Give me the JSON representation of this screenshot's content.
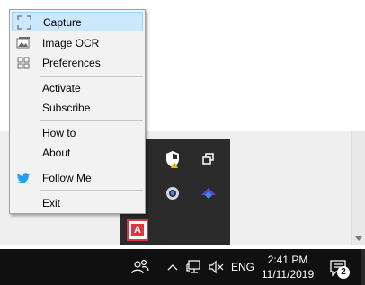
{
  "menu": {
    "items": [
      {
        "label": "Capture",
        "icon": "capture-icon",
        "selected": true
      },
      {
        "label": "Image OCR",
        "icon": "image-icon"
      },
      {
        "label": "Preferences",
        "icon": "grid-icon"
      },
      {
        "label": "Activate"
      },
      {
        "label": "Subscribe"
      },
      {
        "label": "How to"
      },
      {
        "label": "About"
      },
      {
        "label": "Follow Me",
        "icon": "twitter-icon"
      },
      {
        "label": "Exit"
      }
    ]
  },
  "tray_flyout": {
    "icons": [
      "security-shield-icon",
      "multi-window-icon",
      "ring-icon",
      "arrow-up-icon",
      "app-a-icon"
    ],
    "app_letter": "A"
  },
  "taskbar": {
    "language": "ENG",
    "time": "2:41 PM",
    "date": "11/11/2019",
    "notification_count": "2"
  },
  "colors": {
    "menu_bg": "#f2f2f2",
    "menu_highlight": "#cce8ff",
    "taskbar_bg": "#101010",
    "flyout_bg": "#2b2b2b",
    "twitter_blue": "#1da1f2",
    "app_red": "#d9373f"
  }
}
